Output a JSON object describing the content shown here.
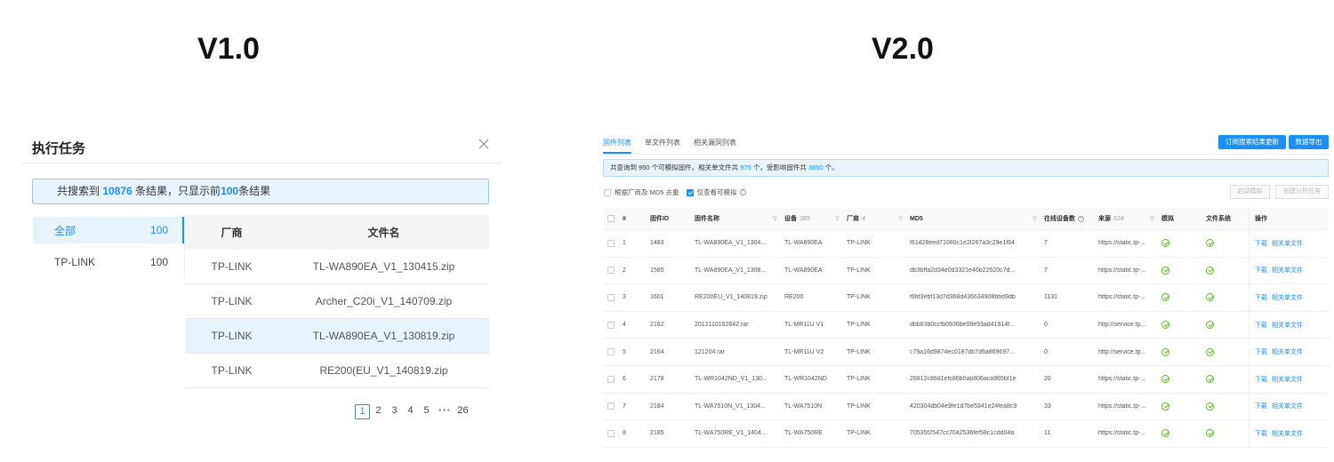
{
  "headings": {
    "v1": "V1.0",
    "v2": "V2.0"
  },
  "v1": {
    "title": "执行任务",
    "info": {
      "prefix": "共搜索到 ",
      "total": "10876",
      "mid": " 条结果，只显示前",
      "limit": "100",
      "suffix": "条结果"
    },
    "categories": [
      {
        "label": "全部",
        "count": "100"
      },
      {
        "label": "TP-LINK",
        "count": "100"
      }
    ],
    "table": {
      "headers": [
        "厂商",
        "文件名"
      ],
      "rows": [
        [
          "TP-LINK",
          "TL-WA890EA_V1_130415.zip"
        ],
        [
          "TP-LINK",
          "Archer_C20i_V1_140709.zip"
        ],
        [
          "TP-LINK",
          "TL-WA890EA_V1_130819.zip"
        ],
        [
          "TP-LINK",
          "RE200(EU_V1_140819.zip"
        ]
      ]
    },
    "pager": {
      "pages": [
        "1",
        "2",
        "3",
        "4",
        "5"
      ],
      "ellipsis": "•••",
      "last": "26"
    }
  },
  "v2": {
    "tabs": [
      "固件列表",
      "单文件列表",
      "相关漏洞列表"
    ],
    "buttons": {
      "subscribe": "订阅搜索结果更新",
      "export": "数据导出",
      "start": "启动模拟",
      "create": "创建分析任务"
    },
    "info": {
      "p1": "共查询到 950 个可模拟固件。相关单文件共 ",
      "n1": "975",
      "p2": " 个，受影响固件共 ",
      "n2": "3850",
      "p3": " 个。"
    },
    "options": {
      "dedupe": "根据厂商及 MD5 去重",
      "only_emu": "仅查看可模拟"
    },
    "table": {
      "headers": {
        "idx": "#",
        "id": "固件ID",
        "name": "固件名称",
        "device": "设备",
        "device_count": "385",
        "vendor": "厂商",
        "vendor_count": "4",
        "md5": "MD5",
        "online": "在线设备数",
        "source": "来源",
        "source_count": "524",
        "emu": "模拟",
        "fs": "文件系统",
        "action": "操作"
      },
      "rows": [
        {
          "idx": "1",
          "id": "1483",
          "name": "TL-WA890EA_V1_1304...",
          "device": "TL-WA890EA",
          "vendor": "TP-LINK",
          "md5": "f61d28eed71080c1e2f267a3c29e1f64",
          "online": "7",
          "source": "https://static.tp-..."
        },
        {
          "idx": "2",
          "id": "1585",
          "name": "TL-WA890EA_V1_1308...",
          "device": "TL-WA890EA",
          "vendor": "TP-LINK",
          "md5": "db3bffa2d34e0d3321e46b22620c7d...",
          "online": "7",
          "source": "https://static.tp-..."
        },
        {
          "idx": "3",
          "id": "1601",
          "name": "RE200EU_V1_140819.zip",
          "device": "RE200",
          "vendor": "TP-LINK",
          "md5": "f6fd3ebf13d7d368d436634908bbd9db",
          "online": "1131",
          "source": "https://static.tp-..."
        },
        {
          "idx": "4",
          "id": "2162",
          "name": "2012110162642.rar",
          "device": "TL-MR11U V1",
          "vendor": "TP-LINK",
          "md5": "dbb83b0ccfb0936be08e93ad41914f...",
          "online": "0",
          "source": "http://service.tp..."
        },
        {
          "idx": "5",
          "id": "2164",
          "name": "121204.rar",
          "device": "TL-MR11U V2",
          "vendor": "TP-LINK",
          "md5": "c79a16d9874ec0187db7d6a869697...",
          "online": "0",
          "source": "http://service.tp..."
        },
        {
          "idx": "6",
          "id": "2178",
          "name": "TL-WR1042ND_V1_130...",
          "device": "TL-WR1042ND",
          "vendor": "TP-LINK",
          "md5": "26812c86d1efc86b0ab806aca965bf1e",
          "online": "20",
          "source": "https://static.tp-..."
        },
        {
          "idx": "7",
          "id": "2184",
          "name": "TL-WA7510N_V1_1304...",
          "device": "TL-WA7510N",
          "vendor": "TP-LINK",
          "md5": "420304db04e9fe1d7be5341e24fea8c9",
          "online": "33",
          "source": "https://static.tp-..."
        },
        {
          "idx": "8",
          "id": "2185",
          "name": "TL-WA750RE_V1_1404...",
          "device": "TL-WA750RE",
          "vendor": "TP-LINK",
          "md5": "70535f2547cc7042536fef58c1cdd04a",
          "online": "11",
          "source": "https://static.tp-..."
        }
      ],
      "actions": [
        "下载",
        "相关单文件"
      ]
    }
  },
  "icons": {
    "close": "close-icon",
    "search": "search-icon",
    "help": "help-icon",
    "check": "check-circle-icon"
  },
  "colors": {
    "accent": "#1890ff",
    "info_bg": "#e8f4fd",
    "success": "#52c41a"
  }
}
